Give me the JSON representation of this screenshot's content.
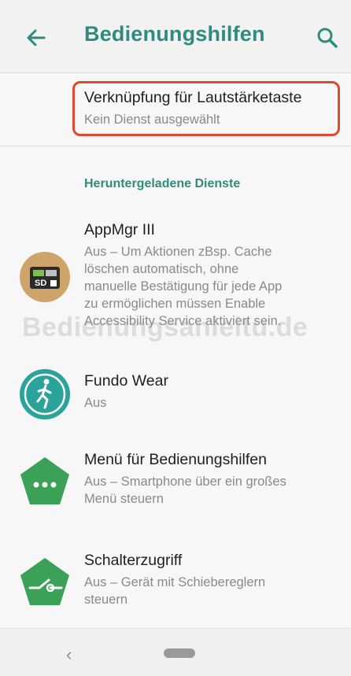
{
  "header": {
    "title": "Bedienungshilfen",
    "back_icon": "arrow-left-icon",
    "search_icon": "search-icon",
    "accent_color": "#2e8b7e"
  },
  "shortcut": {
    "title": "Verknüpfung für Lautstärketaste",
    "subtitle": "Kein Dienst ausgewählt",
    "highlight_color": "#e0482f"
  },
  "section": {
    "header": "Heruntergeladene Dienste"
  },
  "services": [
    {
      "title": "AppMgr III",
      "desc_lines": [
        "Aus – Um Aktionen zBsp. Cache",
        "löschen automatisch, ohne",
        "manuelle Bestätigung für jede App",
        "zu ermöglichen müssen Enable",
        "Accessibility Service aktiviert sein."
      ],
      "icon": "sd-card-app-icon"
    },
    {
      "title": "Fundo Wear",
      "desc_lines": [
        "Aus"
      ],
      "icon": "runner-icon"
    },
    {
      "title": "Menü für Bedienungshilfen",
      "desc_lines": [
        "Aus – Smartphone über ein großes",
        "Menü steuern"
      ],
      "icon": "menu-dots-icon"
    },
    {
      "title": "Schalterzugriff",
      "desc_lines": [
        "Aus – Gerät mit Schiebereglern",
        "steuern"
      ],
      "icon": "switch-access-icon"
    }
  ],
  "watermark": "Bedienungsanleitu.de",
  "navbar": {
    "back_glyph": "‹",
    "back_icon": "nav-back-icon",
    "home_icon": "home-pill-icon"
  }
}
